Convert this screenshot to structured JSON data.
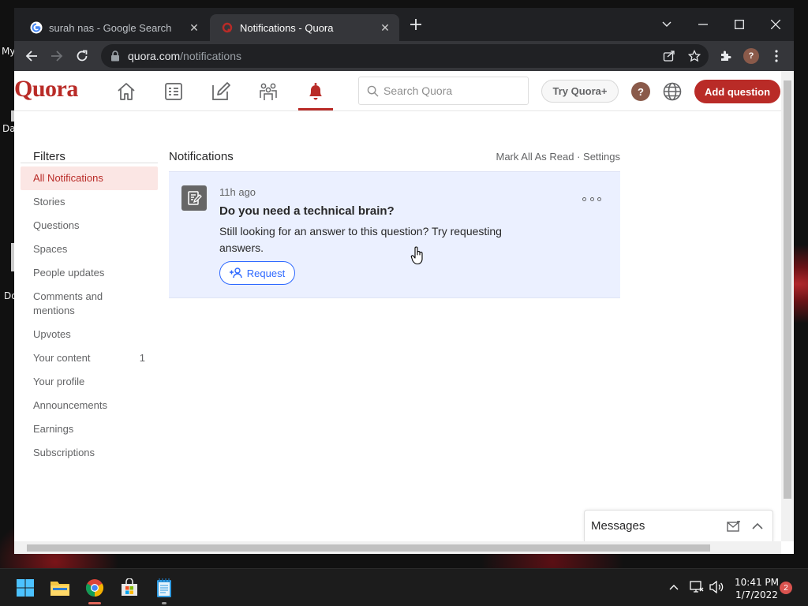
{
  "browser": {
    "tabs": [
      {
        "title": "surah nas - Google Search",
        "active": false
      },
      {
        "title": "Notifications - Quora",
        "active": true
      }
    ],
    "url": {
      "host": "quora.com",
      "path": "/notifications"
    }
  },
  "quora": {
    "logo": "Quora",
    "search_placeholder": "Search Quora",
    "try_plus": "Try Quora+",
    "avatar_initial": "?",
    "add_question": "Add question",
    "brand_color": "#b92b27"
  },
  "filters": {
    "title": "Filters",
    "items": [
      {
        "label": "All Notifications",
        "count": ""
      },
      {
        "label": "Stories",
        "count": ""
      },
      {
        "label": "Questions",
        "count": ""
      },
      {
        "label": "Spaces",
        "count": ""
      },
      {
        "label": "People updates",
        "count": ""
      },
      {
        "label": "Comments and mentions",
        "count": ""
      },
      {
        "label": "Upvotes",
        "count": ""
      },
      {
        "label": "Your content",
        "count": "1"
      },
      {
        "label": "Your profile",
        "count": ""
      },
      {
        "label": "Announcements",
        "count": ""
      },
      {
        "label": "Earnings",
        "count": ""
      },
      {
        "label": "Subscriptions",
        "count": ""
      }
    ]
  },
  "notifications": {
    "title": "Notifications",
    "actions": "Mark All As Read · Settings",
    "items": [
      {
        "time": "11h ago",
        "title": "Do you need a technical brain?",
        "body": "Still looking for an answer to this question? Try requesting answers.",
        "action": "Request"
      }
    ]
  },
  "messages": {
    "label": "Messages"
  },
  "taskbar": {
    "time": "10:41 PM",
    "date": "1/7/2022",
    "notification_count": "2"
  },
  "desktop": {
    "labels": [
      "My",
      "Da",
      "Do"
    ]
  }
}
